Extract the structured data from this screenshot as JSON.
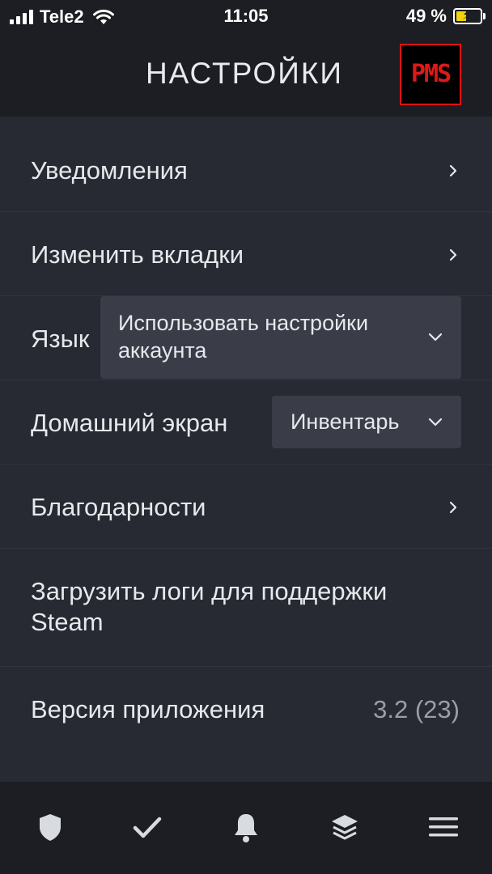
{
  "status_bar": {
    "carrier": "Tele2",
    "time": "11:05",
    "battery_percent": "49 %",
    "battery_level": 0.49,
    "charging": true
  },
  "header": {
    "title": "НАСТРОЙКИ",
    "logo_text": "PMS"
  },
  "settings": {
    "notifications": "Уведомления",
    "edit_tabs": "Изменить вкладки",
    "language_label": "Язык",
    "language_value": "Использовать настройки аккаунта",
    "home_screen_label": "Домашний экран",
    "home_screen_value": "Инвентарь",
    "credits": "Благодарности",
    "upload_logs": "Загрузить логи для поддержки Steam",
    "app_version_label": "Версия приложения",
    "app_version_value": "3.2 (23)"
  },
  "tabbar": {
    "tabs": [
      "shield-icon",
      "checkmark-icon",
      "bell-icon",
      "layers-icon",
      "menu-icon"
    ]
  },
  "colors": {
    "background": "#272a32",
    "bar": "#1c1e23",
    "dropdown": "#3a3d48",
    "battery": "#f5d30a",
    "logo_red": "#e01010"
  }
}
